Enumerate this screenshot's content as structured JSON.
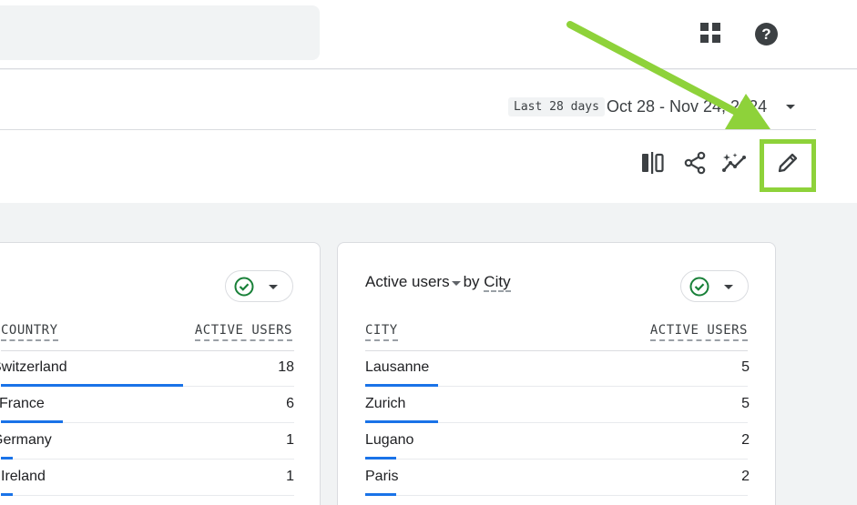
{
  "header": {
    "apps_icon": "apps-grid-icon",
    "help_icon": "help-circle-icon"
  },
  "date": {
    "chip": "Last 28 days",
    "range": "Oct 28 - Nov 24, 2024"
  },
  "toolbar": {
    "icons": [
      "compare-columns-icon",
      "share-icon",
      "insights-icon",
      "edit-pencil-icon"
    ]
  },
  "colors": {
    "accent_blue": "#1a73e8",
    "highlight_green": "#8ed23a",
    "check_green": "#188038"
  },
  "cards": {
    "left": {
      "head_dim": "COUNTRY",
      "head_metric": "ACTIVE USERS",
      "rows": [
        {
          "name": "Switzerland",
          "value": "18",
          "share": 0.62
        },
        {
          "name": "France",
          "value": "6",
          "share": 0.21
        },
        {
          "name": "Germany",
          "value": "1",
          "share": 0.04
        },
        {
          "name": "Ireland",
          "value": "1",
          "share": 0.04
        }
      ]
    },
    "right": {
      "title_metric": "Active users",
      "title_by": "by",
      "title_dim": "City",
      "head_dim": "CITY",
      "head_metric": "ACTIVE USERS",
      "rows": [
        {
          "name": "Lausanne",
          "value": "5",
          "share": 0.19
        },
        {
          "name": "Zurich",
          "value": "5",
          "share": 0.19
        },
        {
          "name": "Lugano",
          "value": "2",
          "share": 0.08
        },
        {
          "name": "Paris",
          "value": "2",
          "share": 0.08
        }
      ]
    }
  }
}
